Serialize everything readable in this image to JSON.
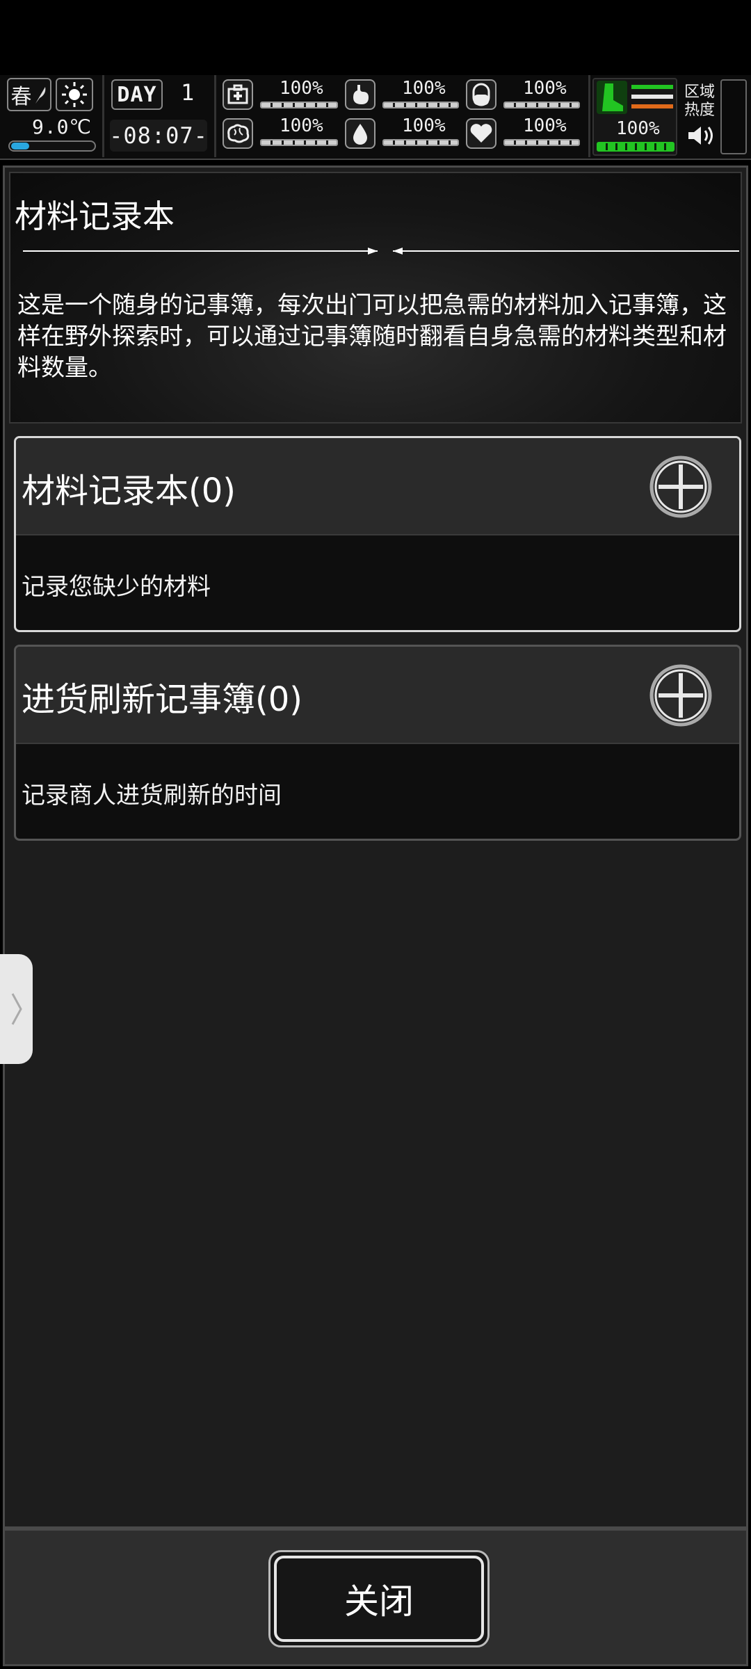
{
  "hud": {
    "season": "春",
    "temperature": "9.0℃",
    "day_label": "DAY",
    "day_number": "1",
    "time": "-08:07-",
    "stats_top": [
      {
        "icon": "medkit-icon",
        "value": "100%",
        "level": 1.0
      },
      {
        "icon": "stomach-icon",
        "value": "100%",
        "level": 1.0
      },
      {
        "icon": "pill-icon",
        "value": "100%",
        "level": 1.0
      }
    ],
    "stats_bottom": [
      {
        "icon": "brain-icon",
        "value": "100%",
        "level": 1.0
      },
      {
        "icon": "water-drop-icon",
        "value": "100%",
        "level": 1.0
      },
      {
        "icon": "heart-icon",
        "value": "100%",
        "level": 1.0
      }
    ],
    "stamina_value": "100%",
    "stamina_level": 1.0,
    "region_label": "区域热度",
    "colors": {
      "accent_green": "#22c422",
      "accent_orange": "#e06a1a",
      "temp_blue": "#2aa7e0"
    }
  },
  "intro": {
    "title": "材料记录本",
    "description": "这是一个随身的记事簿，每次出门可以把急需的材料加入记事簿，这样在野外探索时，可以通过记事簿随时翻看自身急需的材料类型和材料数量。"
  },
  "cards": [
    {
      "title": "材料记录本(0)",
      "subtitle": "记录您缺少的材料",
      "selected": true
    },
    {
      "title": "进货刷新记事簿(0)",
      "subtitle": "记录商人进货刷新的时间",
      "selected": false
    }
  ],
  "footer": {
    "close_label": "关闭"
  }
}
